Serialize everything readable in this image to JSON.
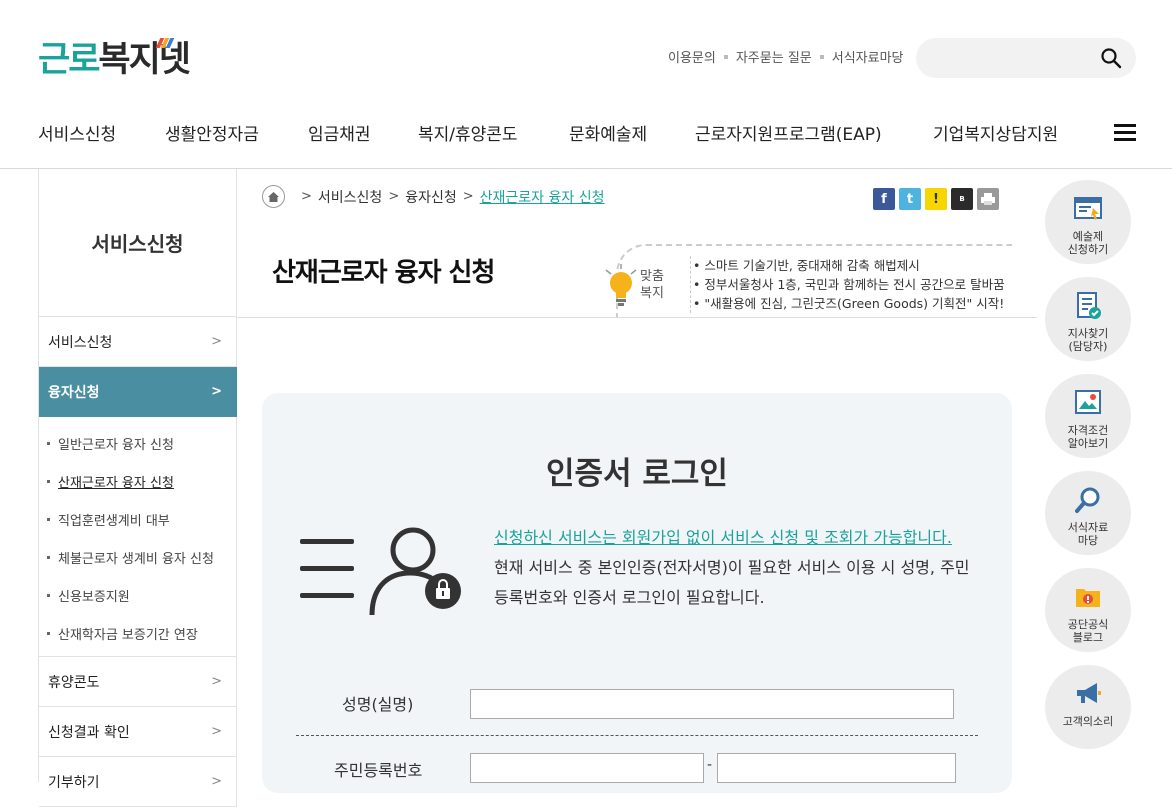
{
  "header": {
    "logo_part1": "근로",
    "logo_part2": "복지넷",
    "util_links": [
      "이용문의",
      "자주묻는 질문",
      "서식자료마당"
    ],
    "search_placeholder": "",
    "gnb": [
      "서비스신청",
      "생활안정자금",
      "임금채권",
      "복지/휴양콘도",
      "문화예술제",
      "근로자지원프로그램(EAP)",
      "기업복지상담지원"
    ]
  },
  "lnb": {
    "title": "서비스신청",
    "items": [
      {
        "label": "서비스신청"
      },
      {
        "label": "융자신청"
      },
      {
        "label": "휴양콘도"
      },
      {
        "label": "신청결과 확인"
      },
      {
        "label": "기부하기"
      }
    ],
    "sub_items": [
      "일반근로자 융자 신청",
      "산재근로자 융자 신청",
      "직업훈련생계비 대부",
      "체불근로자 생계비 융자 신청",
      "신용보증지원",
      "산재학자금 보증기간 연장"
    ]
  },
  "breadcrumb": [
    "서비스신청",
    "융자신청",
    "산재근로자 융자 신청"
  ],
  "page_title": "산재근로자 융자 신청",
  "notice": {
    "label_line1": "맞춤",
    "label_line2": "복지",
    "items": [
      "스마트 기술기반, 중대재해 감축 해법제시",
      "정부서울청사 1층, 국민과 함께하는 전시 공간으로 탈바꿈",
      "\"새활용에 진심, 그린굿즈(Green Goods) 기획전\" 시작!"
    ]
  },
  "login": {
    "title": "인증서 로그인",
    "msg_link": "신청하신 서비스는 회원가입 없이 서비스 신청 및 조회가 가능합니다.",
    "msg_text": "현재 서비스 중 본인인증(전자서명)이 필요한 서비스 이용 시 성명, 주민등록번호와 인증서 로그인이 필요합니다.",
    "name_label": "성명(실명)",
    "rrn_label": "주민등록번호",
    "rrn_dash": "-"
  },
  "quick_menu": [
    {
      "label": "예술제\n신청하기",
      "icon": "art-icon"
    },
    {
      "label": "지사찾기\n(담당자)",
      "icon": "branch-search-icon"
    },
    {
      "label": "자격조건\n알아보기",
      "icon": "qualification-icon"
    },
    {
      "label": "서식자료\n마당",
      "icon": "magnifier-icon"
    },
    {
      "label": "공단공식\n블로그",
      "icon": "blog-icon"
    },
    {
      "label": "고객의소리",
      "icon": "megaphone-icon"
    }
  ],
  "colors": {
    "accent": "#1aa39b",
    "lnb_active": "#4a8ea1",
    "login_bg": "#f1f5f8"
  }
}
